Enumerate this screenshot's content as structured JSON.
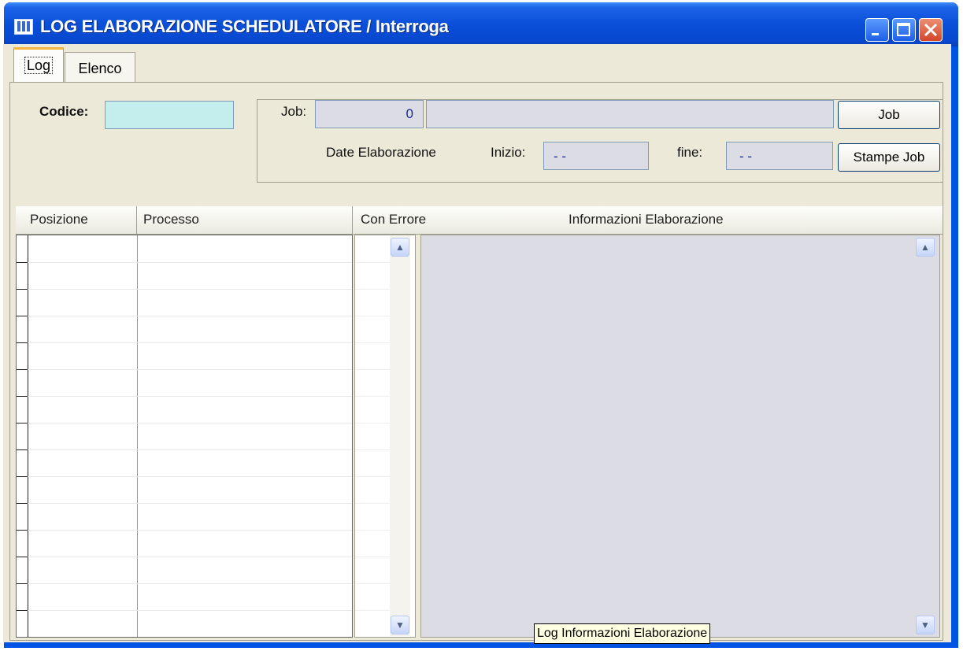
{
  "window": {
    "title": "LOG ELABORAZIONE SCHEDULATORE / Interroga",
    "controls": [
      "minimize-icon",
      "maximize-icon",
      "close-icon"
    ]
  },
  "tabs": [
    {
      "label": "Log",
      "active": true
    },
    {
      "label": "Elenco",
      "active": false
    }
  ],
  "form": {
    "codice_label": "Codice:",
    "codice_value": "",
    "job_label": "Job:",
    "job_number": "0",
    "job_description": "",
    "date_label": "Date Elaborazione",
    "inizio_label": "Inizio:",
    "inizio_value": "- -",
    "fine_label": "fine:",
    "fine_value": "- -",
    "job_button": "Job",
    "stampe_button": "Stampe Job"
  },
  "grid": {
    "columns": [
      "Posizione",
      "Processo",
      "Con Errore",
      "Informazioni Elaborazione"
    ],
    "rows": []
  },
  "tooltip": "Log Informazioni Elaborazione",
  "colors": {
    "titlebar": "#0054e3",
    "client": "#ece9d8",
    "codice_field": "#c4eeee",
    "readonly_field": "#dcdce4",
    "tab_highlight": "#f6b33d"
  }
}
